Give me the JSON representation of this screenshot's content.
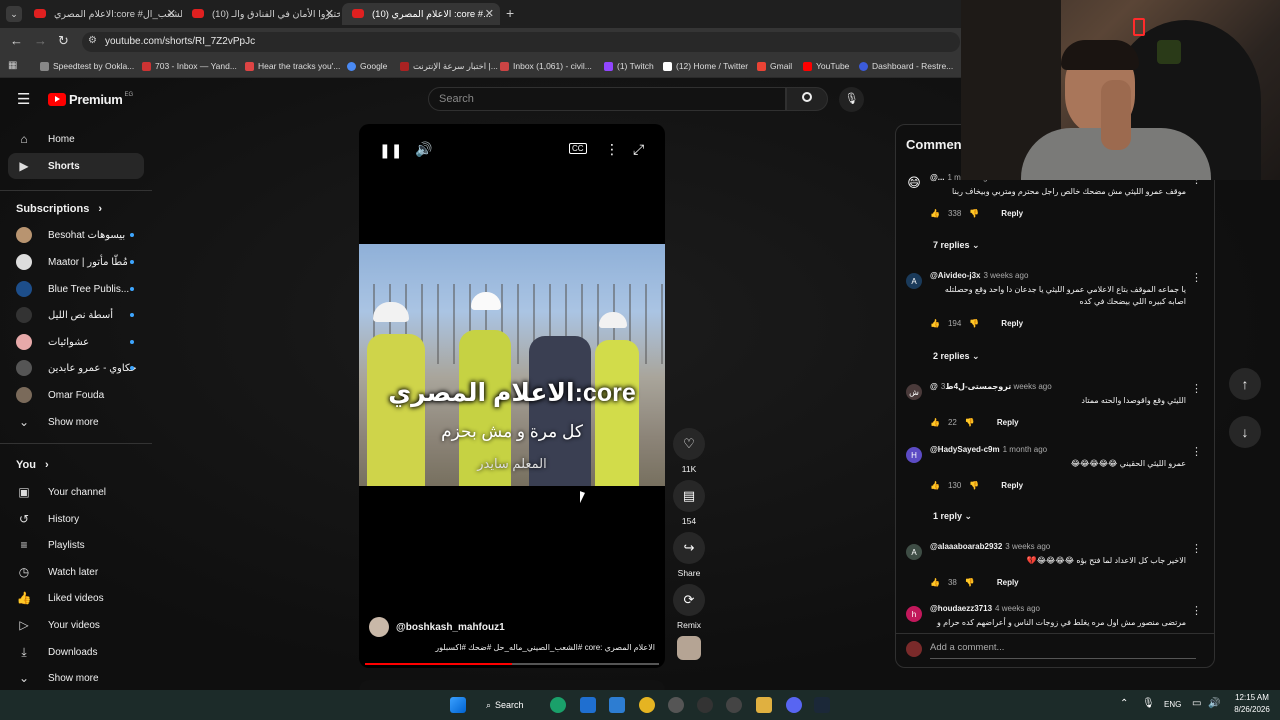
{
  "browser": {
    "tabs": [
      {
        "title": "الاعلام المصري:core #الشعب_ال...",
        "active": false
      },
      {
        "title": "(10) اختبروا الأمان في الفنادق والـ...",
        "active": false
      },
      {
        "title": "(10) الاعلام المصري :core #...",
        "active": true
      }
    ],
    "url": "youtube.com/shorts/RI_7Z2vPpJc",
    "bookmarks": [
      "Speedtest by Ookla...",
      "703 - Inbox — Yand...",
      "Hear the tracks you'...",
      "Google",
      "اختبار سرعة الإنترنت |...",
      "Inbox (1,061) - civil...",
      "(1) Twitch",
      "(12) Home / Twitter",
      "Gmail",
      "YouTube",
      "Dashboard - Restre..."
    ]
  },
  "yt": {
    "logo": "Premium",
    "region": "EG",
    "search_placeholder": "Search",
    "nav": [
      {
        "label": "Home",
        "icon": "home-icon"
      },
      {
        "label": "Shorts",
        "icon": "shorts-icon"
      }
    ],
    "subscriptions_title": "Subscriptions",
    "subscriptions": [
      "Besohat بيسوهات",
      "Maator | مُطّا مأتور",
      "Blue Tree Publis...",
      "أسطة نص الليل",
      "عشوائيات",
      "حكاوي - عمرو عابدين",
      "Omar Fouda"
    ],
    "show_more": "Show more",
    "you_title": "You",
    "you_items": [
      {
        "label": "Your channel",
        "icon": "channel-icon"
      },
      {
        "label": "History",
        "icon": "history-icon"
      },
      {
        "label": "Playlists",
        "icon": "playlists-icon"
      },
      {
        "label": "Watch later",
        "icon": "clock-icon"
      },
      {
        "label": "Liked videos",
        "icon": "like-icon"
      },
      {
        "label": "Your videos",
        "icon": "video-icon"
      },
      {
        "label": "Downloads",
        "icon": "download-icon"
      }
    ],
    "show_more_2": "Show more"
  },
  "video": {
    "overlay_title": "الاعلام المصري:core",
    "caption_line1": "كل مرة و مش بحزم",
    "caption_line2": "المعلم سايدر",
    "channel": "@boshkash_mahfouz1",
    "desc": "الاعلام المصري :core #الشعب_الصيني_ماله_حل #ضحك #اكسبلور"
  },
  "actions": {
    "likes": "11K",
    "comments": "154",
    "share": "Share",
    "remix": "Remix"
  },
  "comments": {
    "header": "Commen",
    "items": [
      {
        "handle": "@...",
        "time": "1 month ago",
        "text": "موقف عمرو الليثي مش مضحك خالص راجل محترم ومتربي وبيخاف ربنا",
        "likes": "338",
        "replies": "7 replies",
        "avatar": "😄"
      },
      {
        "handle": "@Aivideo-j3x",
        "time": "3 weeks ago",
        "text": "يا جماعه الموقف بتاع الاعلامي عمرو الليثي يا جدعان دا واحد وقع وحصلتله اصابه كبيره اللي بيضحك في كده",
        "likes": "194",
        "replies": "2 replies",
        "avatar": "A"
      },
      {
        "handle": "@تروجمستى-ل4ط",
        "time": "3 weeks ago",
        "text": "الليثي وقع واقوصدا والحته ممتاد",
        "likes": "22",
        "replies": "",
        "avatar": "ش"
      },
      {
        "handle": "@HadySayed-c9m",
        "time": "1 month ago",
        "text": "عمرو الليثي الحقيني 😂😂😂😂😂",
        "likes": "130",
        "replies": "1 reply",
        "avatar": "H"
      },
      {
        "handle": "@alaaaboarab2932",
        "time": "3 weeks ago",
        "text": "الاخير جاب كل الاعداد لما فتح بؤه 😂😂😂😂💔",
        "likes": "38",
        "replies": "",
        "avatar": "A"
      },
      {
        "handle": "@houdaezz3713",
        "time": "4 weeks ago",
        "text": "مرتضى منصور مش اول مره يغلط في زوجات الناس و أعراضهم كده حرام و عيب",
        "likes": "",
        "replies": "",
        "avatar": "h"
      }
    ],
    "reply_label": "Reply",
    "add_placeholder": "Add a comment..."
  },
  "taskbar": {
    "search": "Search",
    "lang": "ENG",
    "time": "12:15 AM",
    "date": "8/26/2026"
  }
}
